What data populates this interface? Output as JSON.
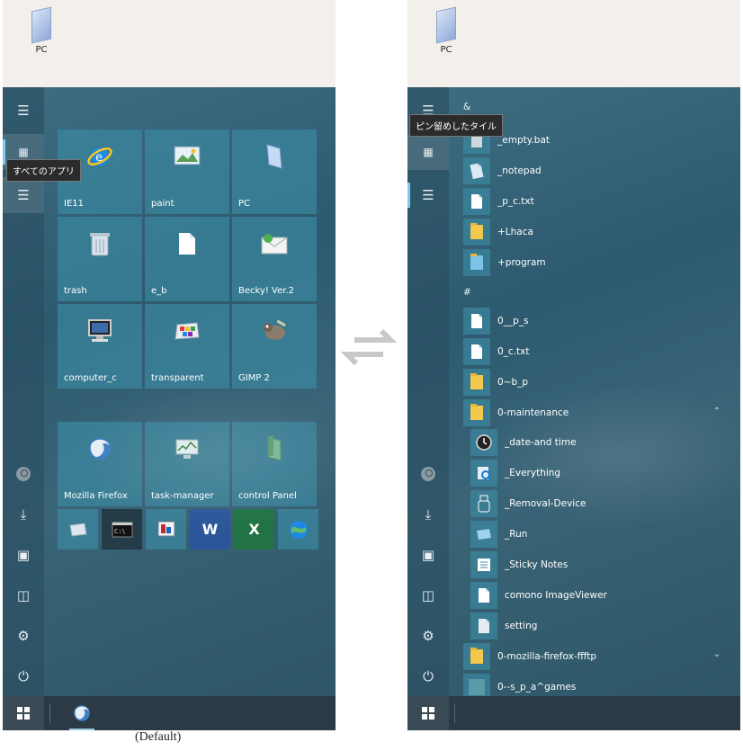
{
  "left": {
    "desktop_icon_label": "PC",
    "tooltip": "すべてのアプリ",
    "tiles_large": [
      {
        "label": "IE11",
        "icon": "ie-icon"
      },
      {
        "label": "paint",
        "icon": "paint-icon"
      },
      {
        "label": "PC",
        "icon": "pc-icon"
      },
      {
        "label": "trash",
        "icon": "trash-icon"
      },
      {
        "label": "e_b",
        "icon": "document-icon"
      },
      {
        "label": "Becky! Ver.2",
        "icon": "mail-icon"
      },
      {
        "label": "computer_c",
        "icon": "computer-icon"
      },
      {
        "label": "transparent",
        "icon": "transparent-icon"
      },
      {
        "label": "GIMP 2",
        "icon": "gimp-icon"
      },
      {
        "label": "Mozilla Firefox",
        "icon": "firefox-icon"
      },
      {
        "label": "task-manager",
        "icon": "task-manager-icon"
      },
      {
        "label": "control Panel",
        "icon": "control-panel-icon"
      }
    ],
    "tiles_small": [
      {
        "icon": "drive-icon"
      },
      {
        "icon": "cmd-icon"
      },
      {
        "icon": "presentation-icon"
      },
      {
        "icon": "word-icon",
        "text": "W"
      },
      {
        "icon": "excel-icon",
        "text": "X"
      },
      {
        "icon": "globe-icon"
      }
    ]
  },
  "right": {
    "desktop_icon_label": "PC",
    "tooltip": "ピン留めしたタイル",
    "group_symbol": "&",
    "group_hash": "#",
    "items_symbol": [
      {
        "label": "_empty.bat",
        "icon": "batch-icon"
      },
      {
        "label": "_notepad",
        "icon": "notepad-icon"
      },
      {
        "label": "_p_c.txt",
        "icon": "text-file-icon"
      },
      {
        "label": "+Lhaca",
        "icon": "folder-icon"
      },
      {
        "label": "+program",
        "icon": "folder-icon"
      }
    ],
    "items_hash": [
      {
        "label": "0__p_s",
        "icon": "document-icon"
      },
      {
        "label": "0_c.txt",
        "icon": "text-file-icon"
      },
      {
        "label": "0~b_p",
        "icon": "folder-icon"
      },
      {
        "label": "0-maintenance",
        "icon": "folder-icon",
        "expanded": true
      }
    ],
    "items_maintenance": [
      {
        "label": "_date-and time",
        "icon": "clock-icon"
      },
      {
        "label": "_Everything",
        "icon": "search-icon"
      },
      {
        "label": "_Removal-Device",
        "icon": "usb-icon"
      },
      {
        "label": "_Run",
        "icon": "run-icon"
      },
      {
        "label": "_Sticky Notes",
        "icon": "sticky-notes-icon"
      },
      {
        "label": "comono ImageViewer",
        "icon": "image-viewer-icon"
      },
      {
        "label": "setting",
        "icon": "settings-file-icon"
      }
    ],
    "items_tail": [
      {
        "label": "0-mozilla-firefox-ffftp",
        "icon": "folder-icon"
      },
      {
        "label": "0--s_p_a^games",
        "icon": "games-icon"
      }
    ]
  },
  "caption": "(Default)",
  "colors": {
    "accent": "#3c8ca5",
    "start_bg": "#2d5a6f",
    "taskbar": "#2b3a44"
  }
}
